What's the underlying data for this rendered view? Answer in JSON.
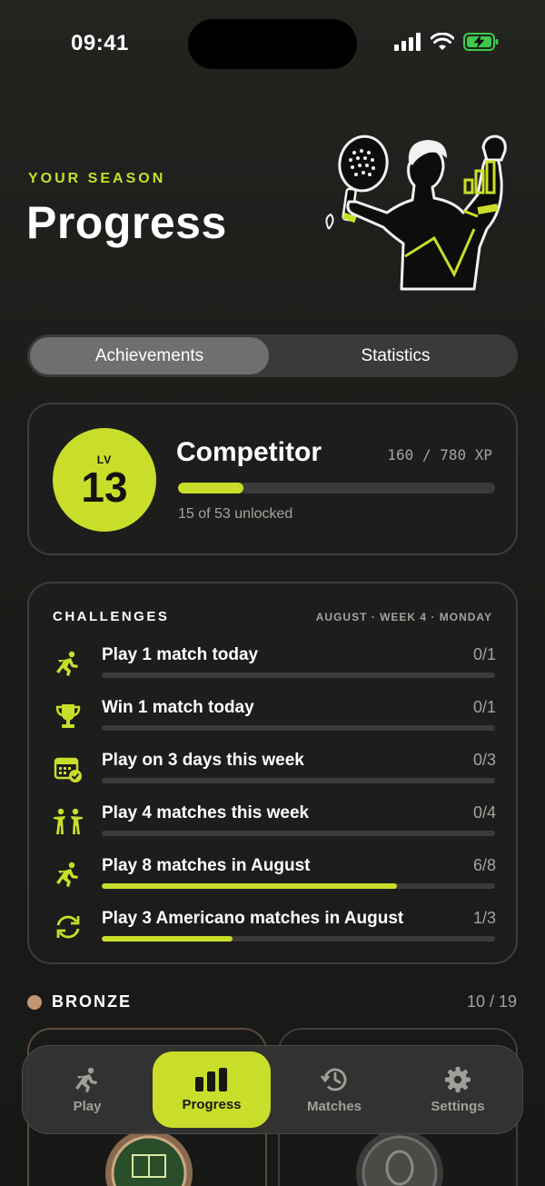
{
  "status_bar": {
    "time": "09:41"
  },
  "header": {
    "eyebrow": "YOUR SEASON",
    "title": "Progress"
  },
  "segments": {
    "active": "Achievements",
    "inactive": "Statistics"
  },
  "level": {
    "lv_label": "LV",
    "number": "13",
    "rank": "Competitor",
    "xp_text": "160 / 780 XP",
    "xp_fraction": 0.205,
    "unlocked": "15 of 53 unlocked"
  },
  "challenges": {
    "title": "CHALLENGES",
    "date": "AUGUST · WEEK 4 · MONDAY",
    "items": [
      {
        "icon": "running-icon",
        "label": "Play 1 match today",
        "count": "0/1",
        "progress": 0
      },
      {
        "icon": "trophy-icon",
        "label": "Win 1 match today",
        "count": "0/1",
        "progress": 0
      },
      {
        "icon": "calendar-check-icon",
        "label": "Play on 3 days this week",
        "count": "0/3",
        "progress": 0
      },
      {
        "icon": "people-icon",
        "label": "Play 4 matches this week",
        "count": "0/4",
        "progress": 0
      },
      {
        "icon": "running-icon",
        "label": "Play 8 matches in August",
        "count": "6/8",
        "progress": 0.75
      },
      {
        "icon": "refresh-icon",
        "label": "Play 3 Americano matches in August",
        "count": "1/3",
        "progress": 0.333
      }
    ]
  },
  "bronze": {
    "label": "BRONZE",
    "count": "10 / 19",
    "dot_color": "#c29672"
  },
  "tabbar": {
    "tabs": [
      {
        "label": "Play",
        "icon": "running-icon",
        "active": false
      },
      {
        "label": "Progress",
        "icon": "bar-chart-icon",
        "active": true
      },
      {
        "label": "Matches",
        "icon": "history-icon",
        "active": false
      },
      {
        "label": "Settings",
        "icon": "gear-icon",
        "active": false
      }
    ]
  },
  "colors": {
    "accent": "#c9de2a",
    "background": "#1b1c19",
    "muted": "#a3a4a0"
  }
}
